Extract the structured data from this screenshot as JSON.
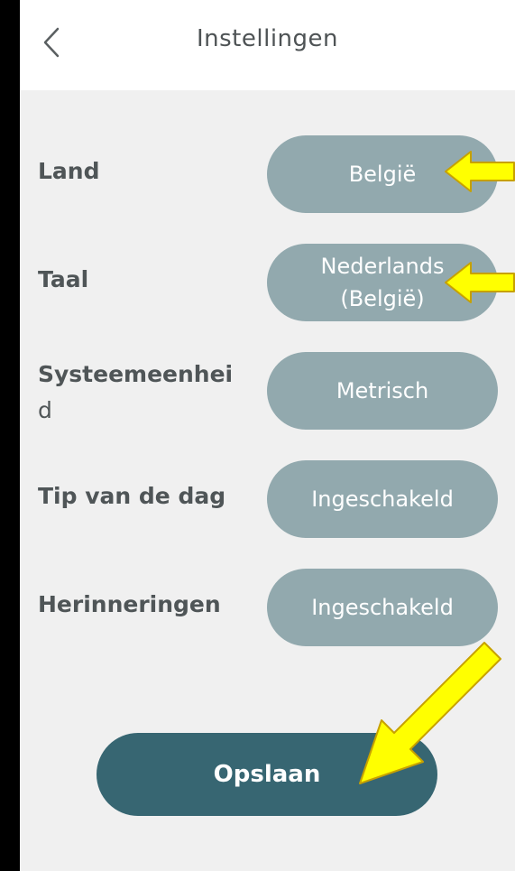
{
  "header": {
    "title": "Instellingen",
    "back_icon": "chevron-left-icon"
  },
  "settings": [
    {
      "label_lines": [
        "Land"
      ],
      "value_lines": [
        "België"
      ]
    },
    {
      "label_lines": [
        "Taal"
      ],
      "value_lines": [
        "Nederlands",
        "(België)"
      ]
    },
    {
      "label_lines": [
        "Systeemeenhei",
        "d"
      ],
      "value_lines": [
        "Metrisch"
      ]
    },
    {
      "label_lines": [
        "Tip van de dag"
      ],
      "value_lines": [
        "Ingeschakeld"
      ]
    },
    {
      "label_lines": [
        "Herinneringen"
      ],
      "value_lines": [
        "Ingeschakeld"
      ]
    }
  ],
  "save_button": {
    "label": "Opslaan"
  },
  "colors": {
    "screen_background": "#f0f0f0",
    "header_background": "#ffffff",
    "pill": "#92a9ae",
    "save_button": "#376672",
    "annotation_arrow": "#ffff00"
  }
}
